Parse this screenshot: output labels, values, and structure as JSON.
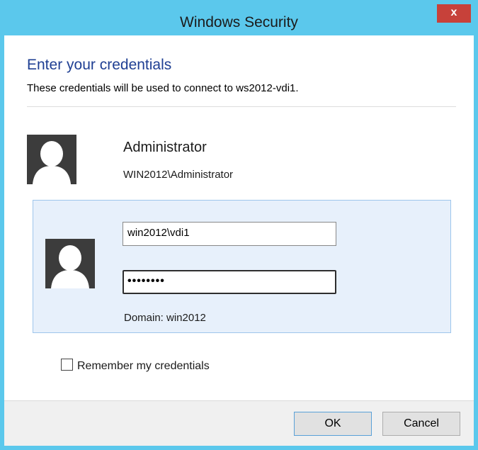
{
  "window": {
    "title": "Windows Security",
    "close_glyph": "x",
    "accent_color": "#5bc8ec",
    "close_color": "#c7413a"
  },
  "dialog": {
    "heading": "Enter your credentials",
    "subtext": "These credentials will be used to connect to ws2012-vdi1."
  },
  "account": {
    "display_name": "Administrator",
    "qualified_name": "WIN2012\\Administrator",
    "avatar_icon": "user-avatar-icon"
  },
  "credential_tile": {
    "username_value": "win2012\\vdi1",
    "password_value": "••••••••",
    "domain_text": "Domain: win2012",
    "avatar_icon": "user-avatar-icon"
  },
  "options": {
    "remember_label": "Remember my credentials",
    "remember_checked": false
  },
  "buttons": {
    "ok_label": "OK",
    "cancel_label": "Cancel"
  }
}
